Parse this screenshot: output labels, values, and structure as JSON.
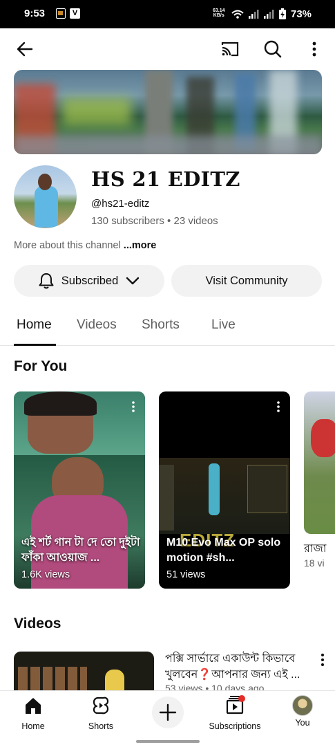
{
  "status_bar": {
    "time": "9:53",
    "net_speed_top": "63.14",
    "net_speed_bottom": "KB/s",
    "battery": "73%"
  },
  "top_bar": {
    "back_icon": "arrow-left",
    "cast_icon": "cast",
    "search_icon": "search",
    "more_icon": "vertical-ellipsis"
  },
  "channel": {
    "name": "HS 21 EDITZ",
    "handle": "@hs21-editz",
    "stats": "130 subscribers • 23 videos",
    "about_text": "More about this channel ",
    "about_more": "...more"
  },
  "actions": {
    "subscribed_label": "Subscribed",
    "community_label": "Visit Community"
  },
  "tabs": [
    {
      "label": "Home",
      "active": true
    },
    {
      "label": "Videos",
      "active": false
    },
    {
      "label": "Shorts",
      "active": false
    },
    {
      "label": "Live",
      "active": false
    }
  ],
  "for_you": {
    "title": "For You",
    "items": [
      {
        "title": "এই শর্ট গান টা দে তো দুইটা ফাঁকা আওয়াজ ...",
        "views": "1.6K views"
      },
      {
        "title": "M10 Evo Max OP solo motion #sh...",
        "views": "51 views",
        "watermark": "EDITZ"
      },
      {
        "title": "রাজা ",
        "views": "18 vi"
      }
    ]
  },
  "videos": {
    "title": "Videos",
    "items": [
      {
        "title": "পক্সি সার্ভারে একাউন্ট কিভাবে খুলবেন❓আপনার জন্য এই ...",
        "meta": "53 views • 10 days ago"
      }
    ]
  },
  "bottom_nav": [
    {
      "label": "Home",
      "icon": "home"
    },
    {
      "label": "Shorts",
      "icon": "shorts"
    },
    {
      "label": "",
      "icon": "plus"
    },
    {
      "label": "Subscriptions",
      "icon": "subscriptions"
    },
    {
      "label": "You",
      "icon": "avatar"
    }
  ],
  "colors": {
    "text_primary": "#0f0f0f",
    "text_secondary": "#606060",
    "button_bg": "#f2f2f2",
    "notification_dot": "#e52d27"
  }
}
